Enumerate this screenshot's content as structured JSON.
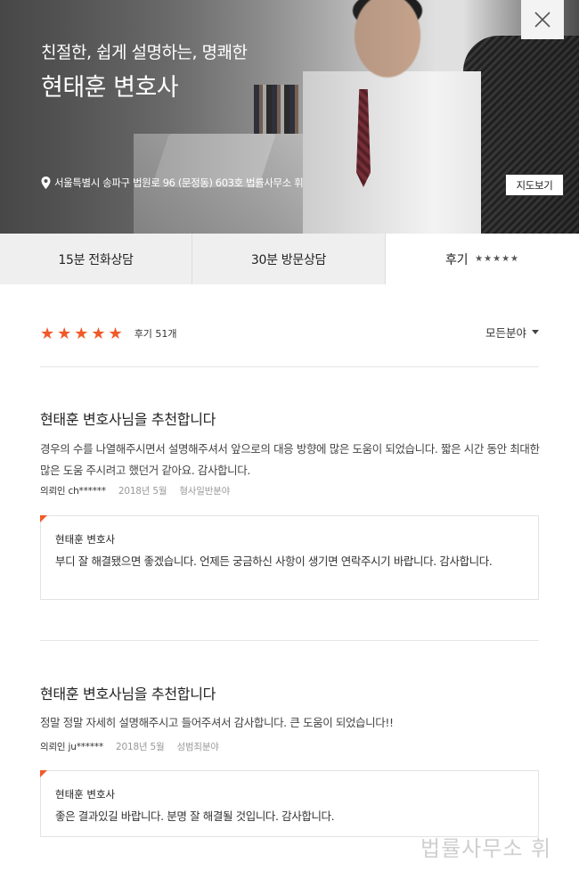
{
  "hero": {
    "tagline": "친절한, 쉽게 설명하는, 명쾌한",
    "name": "현태훈 변호사",
    "address": "서울특별시 송파구 법원로 96 (문정동) 603호 법률사무소 휘",
    "map_button": "지도보기",
    "close_icon": "close-icon",
    "pin_icon": "location-pin-icon"
  },
  "tabs": [
    {
      "label": "15분 전화상담"
    },
    {
      "label": "30분 방문상담"
    },
    {
      "label": "후기",
      "stars": "★★★★★"
    }
  ],
  "summary": {
    "stars": "★★★★★",
    "rating": 5,
    "count_label": "후기 51개",
    "filter_label": "모든분야"
  },
  "reviews": [
    {
      "title": "현태훈 변호사님을 추천합니다",
      "body": "경우의 수를 나열해주시면서 설명해주셔서 앞으로의 대응 방향에 많은 도움이 되었습니다. 짧은 시간 동안 최대한 많은 도움 주시려고 했던거 같아요.  감사합니다.",
      "author": "의뢰인 ch******",
      "date": "2018년 5월",
      "category": "형사일반분야",
      "reply": {
        "name": "현태훈 변호사",
        "text": "부디 잘 해결됐으면 좋겠습니다. 언제든 궁금하신 사항이 생기면 연락주시기 바랍니다. 감사합니다."
      }
    },
    {
      "title": "현태훈 변호사님을 추천합니다",
      "body": "정말 정말 자세히 설명해주시고 들어주셔서 감사합니다. 큰 도움이 되었습니다!!",
      "author": "의뢰인 ju******",
      "date": "2018년 5월",
      "category": "성범죄분야",
      "reply": {
        "name": "현태훈 변호사",
        "text": "좋은 결과있길 바랍니다. 분명 잘 해결될 것입니다. 감사합니다."
      }
    }
  ],
  "watermark": "법률사무소 휘",
  "colors": {
    "accent": "#f05a28",
    "tab_bg": "#efefef",
    "divider": "#e6e6e6"
  }
}
